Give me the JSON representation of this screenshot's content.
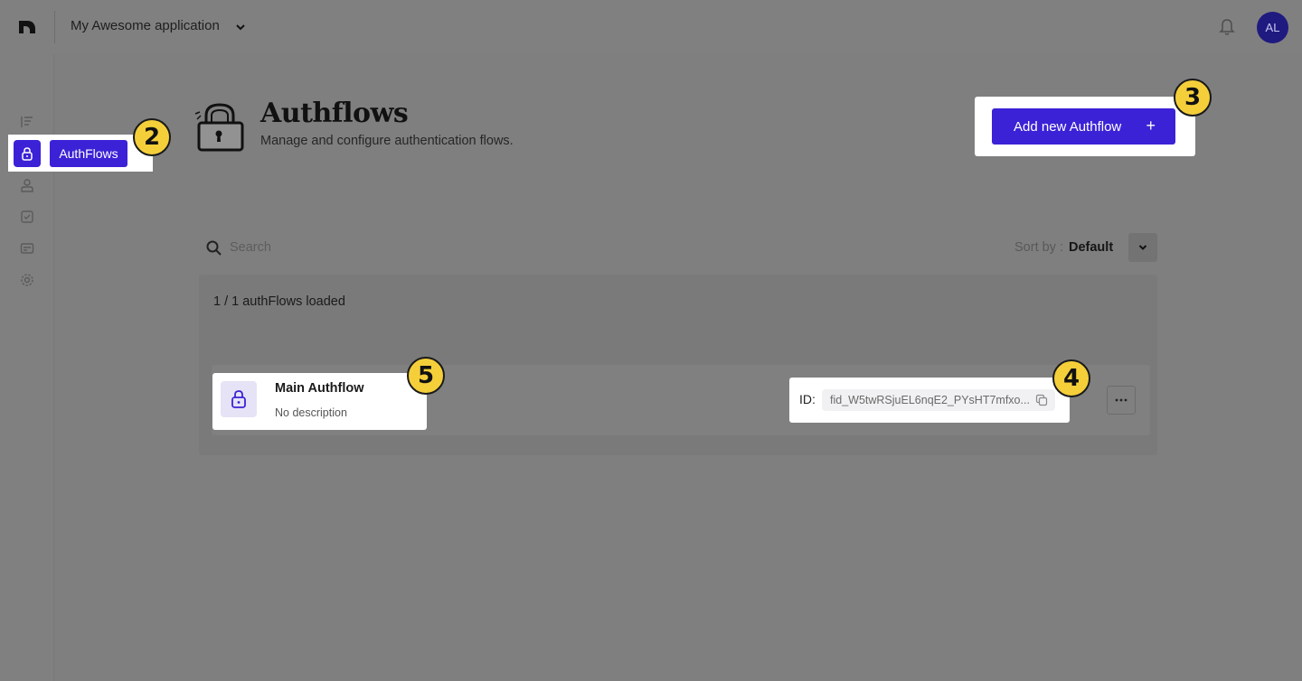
{
  "topbar": {
    "app_name": "My Awesome application",
    "avatar_initials": "AL"
  },
  "sidebar": {
    "items": [
      {
        "icon": "list-icon"
      },
      {
        "icon": "lock-icon",
        "label": "AuthFlows",
        "active": true
      },
      {
        "icon": "user-icon"
      },
      {
        "icon": "checkbox-icon"
      },
      {
        "icon": "card-icon"
      },
      {
        "icon": "gear-icon"
      }
    ]
  },
  "badges": {
    "nav": "2",
    "add": "3",
    "id": "4",
    "name": "5"
  },
  "header": {
    "title": "Authflows",
    "subtitle": "Manage and configure authentication flows."
  },
  "add_button": {
    "label": "Add new Authflow",
    "icon": "+"
  },
  "search": {
    "placeholder": "Search"
  },
  "sort": {
    "label": "Sort by :",
    "value": "Default"
  },
  "list": {
    "loaded_text": "1 / 1 authFlows loaded",
    "items": [
      {
        "name": "Main Authflow",
        "description": "No description",
        "id_label": "ID:",
        "id_value": "fid_W5twRSjuEL6nqE2_PYsHT7mfxo..."
      }
    ]
  },
  "colors": {
    "accent": "#3b22d6",
    "badge": "#f5cf3a",
    "overlay": "#808080"
  }
}
